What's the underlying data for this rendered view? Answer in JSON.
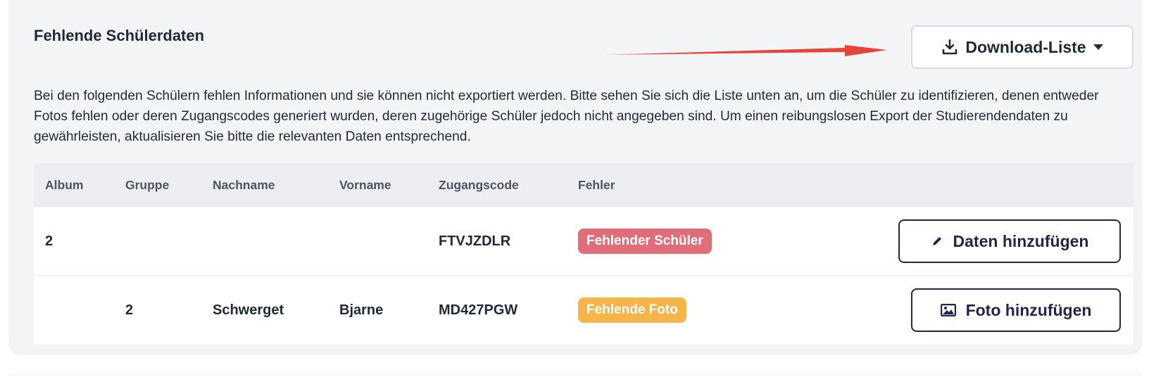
{
  "section": {
    "title": "Fehlende Schülerdaten",
    "download_label": "Download-Liste",
    "description": "Bei den folgenden Schülern fehlen Informationen und sie können nicht exportiert werden. Bitte sehen Sie sich die Liste unten an, um die Schüler zu identifizieren, denen entweder Fotos fehlen oder deren Zugangscodes generiert wurden, deren zugehörige Schüler jedoch nicht angegeben sind. Um einen reibungslosen Export der Studierendendaten zu gewährleisten, aktualisieren Sie bitte die relevanten Daten entsprechend."
  },
  "table": {
    "headers": {
      "album": "Album",
      "gruppe": "Gruppe",
      "nachname": "Nachname",
      "vorname": "Vorname",
      "zugangscode": "Zugangscode",
      "fehler": "Fehler"
    },
    "rows": [
      {
        "album": "2",
        "gruppe": "",
        "nachname": "",
        "vorname": "",
        "zugangscode": "FTVJZDLR",
        "fehler": "Fehlender Schüler",
        "action": "Daten hinzufügen"
      },
      {
        "album": "",
        "gruppe": "2",
        "nachname": "Schwerget",
        "vorname": "Bjarne",
        "zugangscode": "MD427PGW",
        "fehler": "Fehlende Foto",
        "action": "Foto hinzufügen"
      }
    ]
  },
  "colors": {
    "annotation_arrow": "#e5463a",
    "badge_missing_student": "#e06e78",
    "badge_missing_photo": "#f6b548",
    "button_outline": "#23264a"
  },
  "icons": {
    "download": "download-icon",
    "caret": "caret-down-icon",
    "edit": "pencil-icon",
    "photo": "image-icon"
  }
}
